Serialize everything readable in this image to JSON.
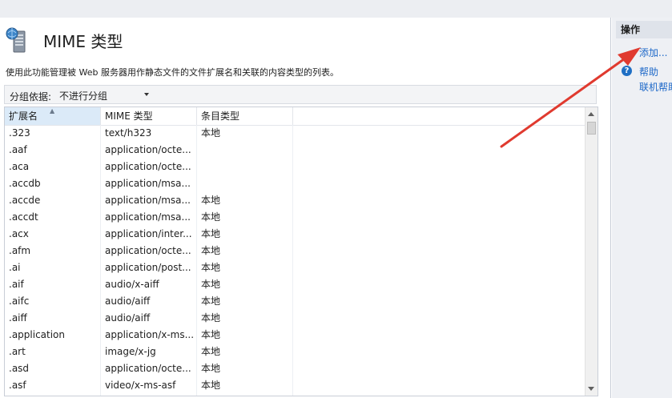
{
  "page": {
    "title": "MIME 类型",
    "description": "使用此功能管理被 Web 服务器用作静态文件的文件扩展名和关联的内容类型的列表。"
  },
  "group": {
    "label": "分组依据:",
    "value": "不进行分组"
  },
  "table": {
    "headers": [
      "扩展名",
      "MIME 类型",
      "条目类型"
    ],
    "rows": [
      [
        ".323",
        "text/h323",
        "本地"
      ],
      [
        ".aaf",
        "application/octe...",
        ""
      ],
      [
        ".aca",
        "application/octe...",
        ""
      ],
      [
        ".accdb",
        "application/msa...",
        ""
      ],
      [
        ".accde",
        "application/msa...",
        "本地"
      ],
      [
        ".accdt",
        "application/msa...",
        "本地"
      ],
      [
        ".acx",
        "application/inter...",
        "本地"
      ],
      [
        ".afm",
        "application/octe...",
        "本地"
      ],
      [
        ".ai",
        "application/post...",
        "本地"
      ],
      [
        ".aif",
        "audio/x-aiff",
        "本地"
      ],
      [
        ".aifc",
        "audio/aiff",
        "本地"
      ],
      [
        ".aiff",
        "audio/aiff",
        "本地"
      ],
      [
        ".application",
        "application/x-ms...",
        "本地"
      ],
      [
        ".art",
        "image/x-jg",
        "本地"
      ],
      [
        ".asd",
        "application/octe...",
        "本地"
      ],
      [
        ".asf",
        "video/x-ms-asf",
        "本地"
      ]
    ]
  },
  "actions": {
    "header": "操作",
    "add": "添加...",
    "help": "帮助",
    "online_help": "联机帮助"
  },
  "colors": {
    "link": "#1d68c8",
    "annotation_arrow": "#e03a2f",
    "sorted_header": "#dbeaf8"
  }
}
